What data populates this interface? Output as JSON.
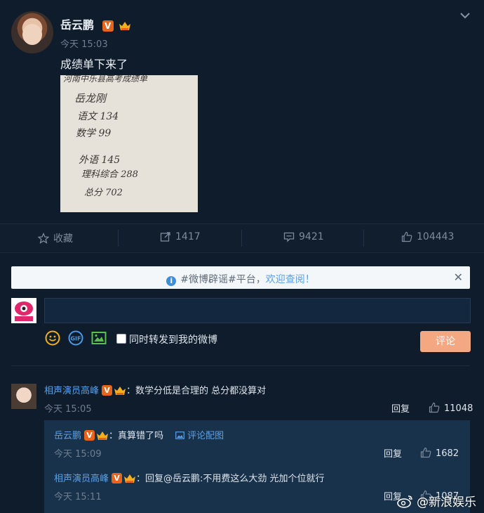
{
  "post": {
    "author": "岳云鹏",
    "time": "今天 15:03",
    "text": "成绩单下来了",
    "photo_lines": [
      "河南中乐县高考成绩单",
      "岳龙刚",
      "语文 134",
      "数学 99",
      "外语 145",
      "理科综合 288",
      "总分 702"
    ]
  },
  "actions": {
    "favorite": "收藏",
    "repost": "1417",
    "comment": "9421",
    "like": "104443"
  },
  "notice": {
    "text": "#微博辟谣#平台，",
    "link": "欢迎查阅！"
  },
  "composer": {
    "forward_label": "同时转发到我的微博",
    "submit": "评论"
  },
  "comments": [
    {
      "author": "相声演员高峰",
      "text": "：数学分低是合理的 总分都没算对",
      "time": "今天 15:05",
      "reply": "回复",
      "likes": "11048"
    }
  ],
  "replies": [
    {
      "author": "岳云鹏",
      "text": "：真算错了吗",
      "link": "评论配图",
      "time": "今天 15:09",
      "reply": "回复",
      "likes": "1682"
    },
    {
      "author": "相声演员高峰",
      "prefix": "：回复",
      "mention": "@岳云鹏",
      "text": ":不用费这么大劲 光加个位就行",
      "time": "今天 15:11",
      "reply": "回复",
      "likes": "1087"
    }
  ],
  "watermark": "@新浪娱乐",
  "colors": {
    "background": "#0f1c2b",
    "link": "#5aa0e6",
    "verified_badge": "#e8641b",
    "submit_button": "#f3a881"
  }
}
